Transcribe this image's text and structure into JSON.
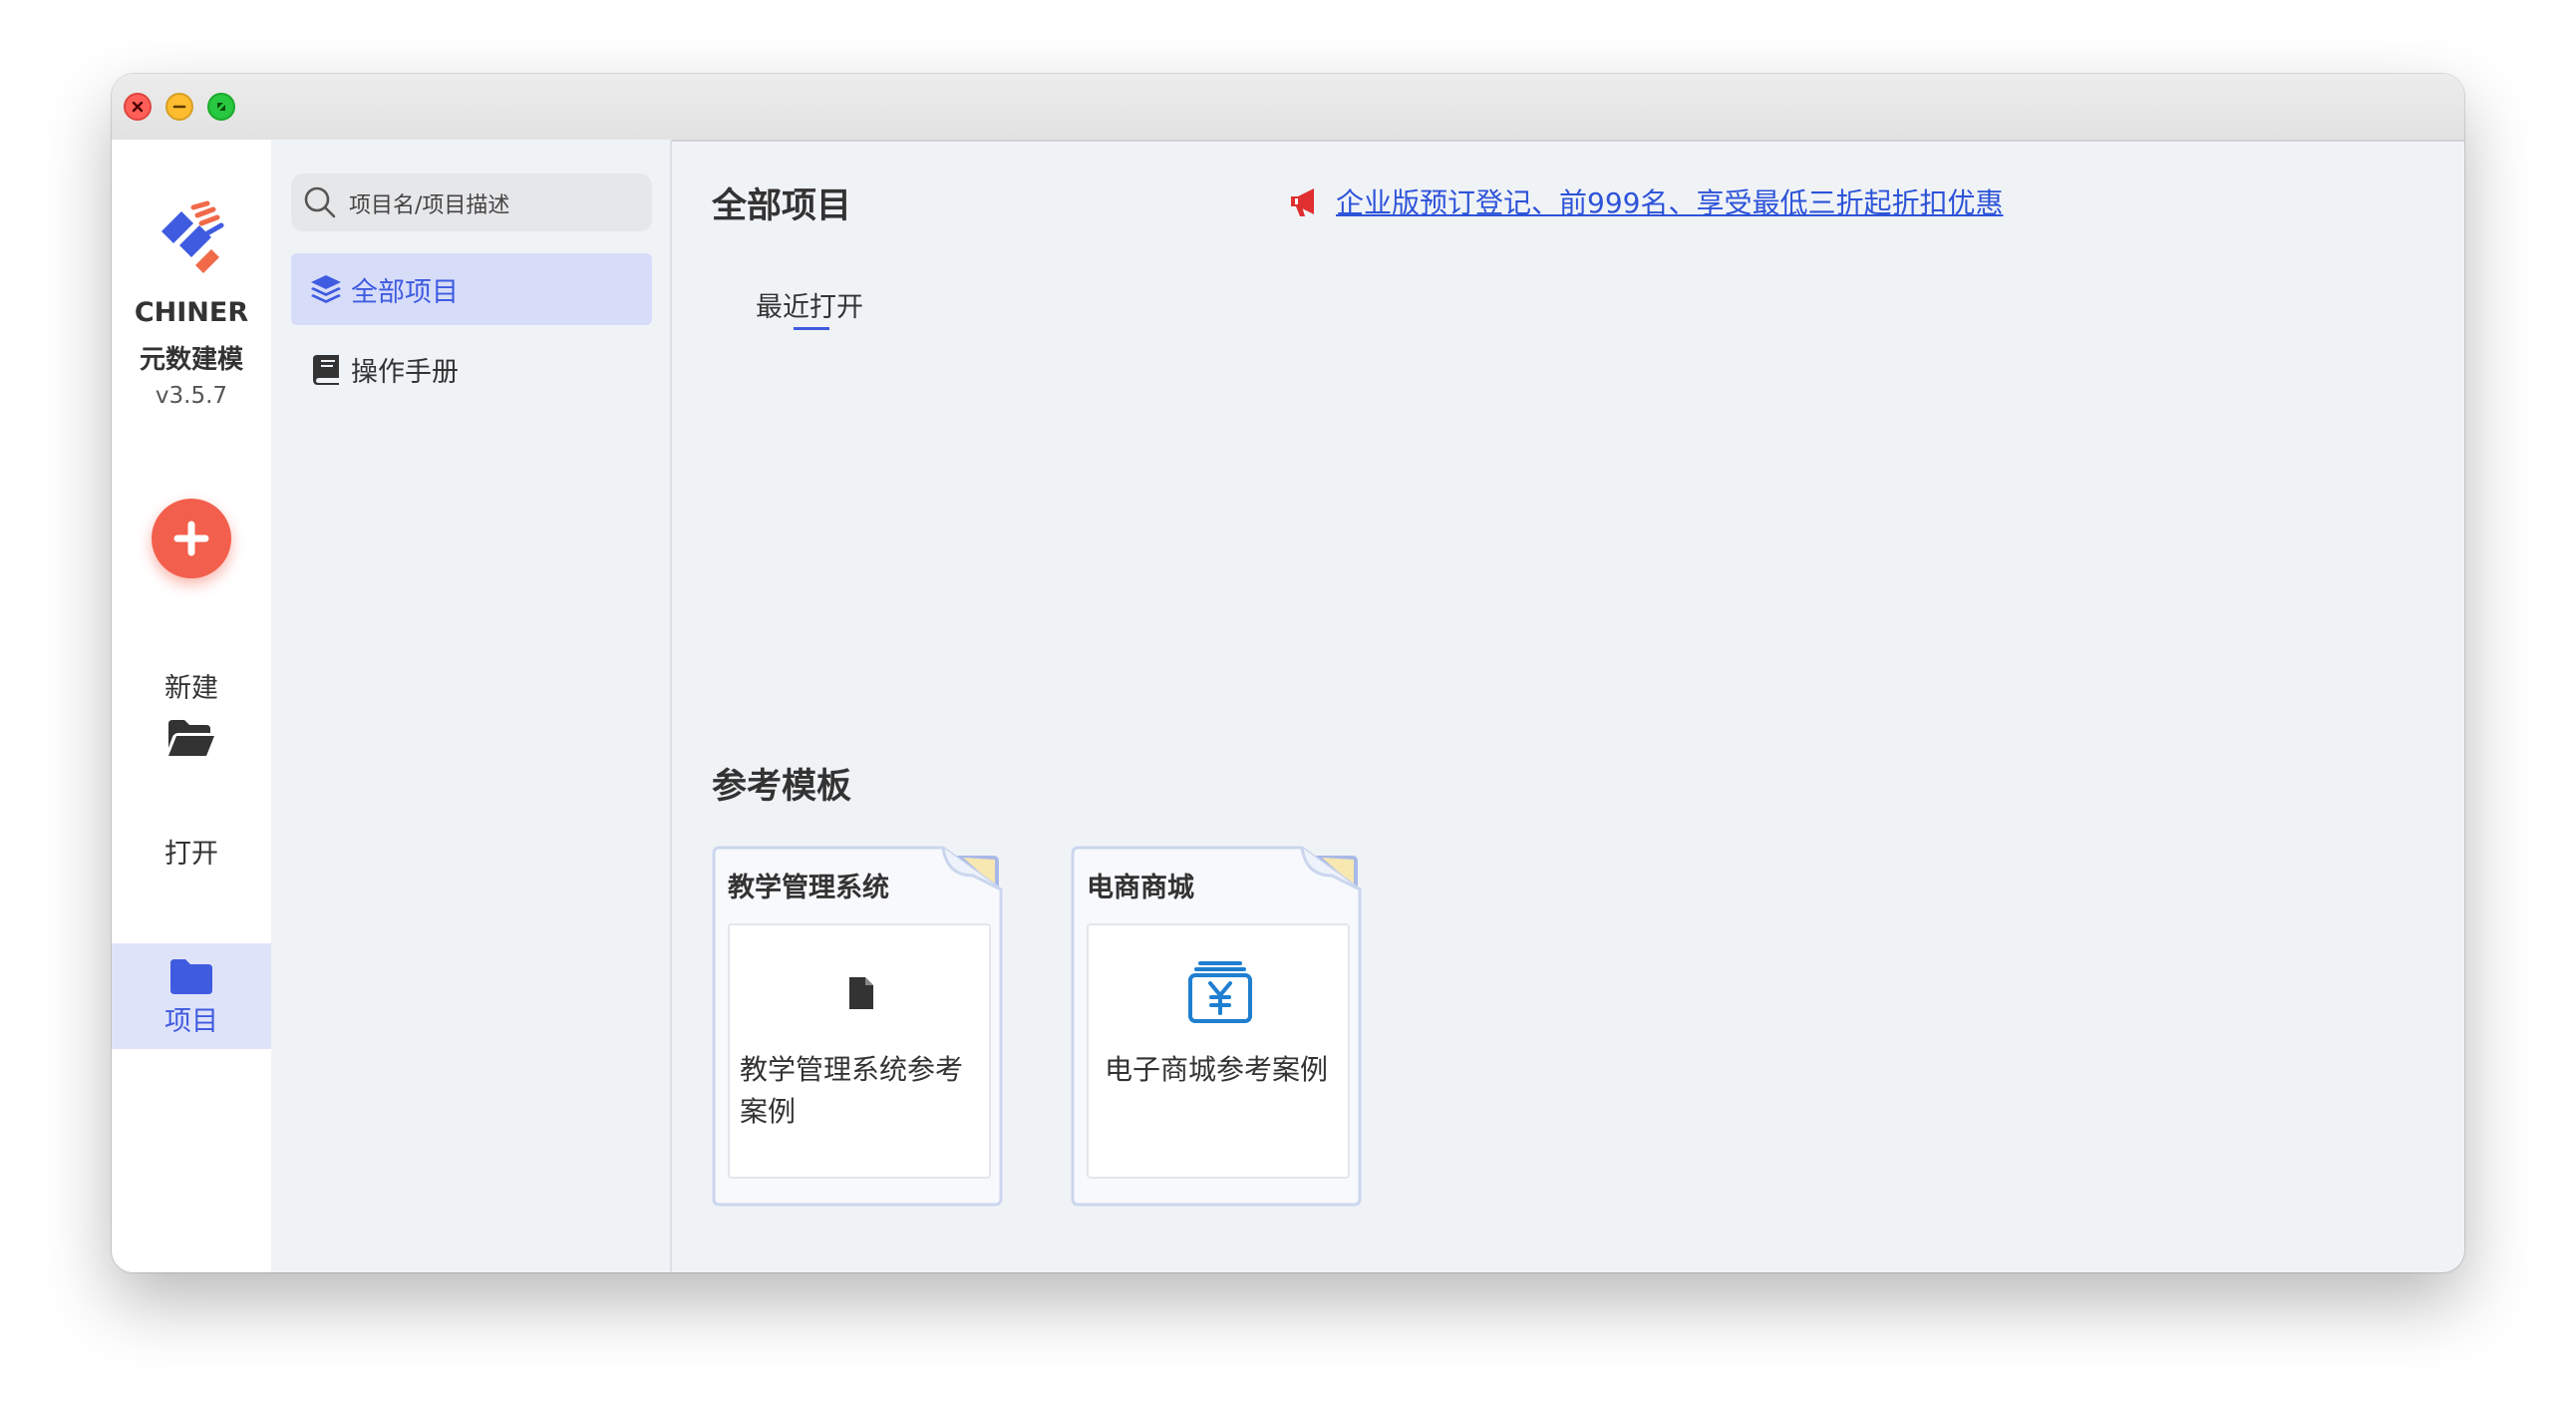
{
  "window": {
    "controls": {
      "close": "close-button",
      "minimize": "minimize-button",
      "zoom": "zoom-button"
    }
  },
  "app": {
    "name": "CHINER",
    "subtitle": "元数建模",
    "version": "v3.5.7"
  },
  "rail": {
    "new_label": "新建",
    "open_label": "打开",
    "project_label": "项目"
  },
  "sidebar": {
    "search_placeholder": "项目名/项目描述",
    "items": [
      {
        "label": "全部项目",
        "icon": "layers-icon",
        "active": true
      },
      {
        "label": "操作手册",
        "icon": "book-icon",
        "active": false
      }
    ]
  },
  "main": {
    "title": "全部项目",
    "promo_text": "企业版预订登记、前999名、享受最低三折起折扣优惠",
    "recent_tab": "最近打开",
    "templates_title": "参考模板",
    "templates": [
      {
        "title": "教学管理系统",
        "desc": "教学管理系统参考案例",
        "icon": "document-icon"
      },
      {
        "title": "电商商城",
        "desc": "电子商城参考案例",
        "icon": "cash-register-icon"
      }
    ]
  },
  "colors": {
    "accent": "#3f5be0",
    "active_bg": "#d7ddf9",
    "new_button": "#f25f4c",
    "promo_link": "#2d53d9",
    "promo_icon": "#e02f2f",
    "content_bg": "#f0f3f6"
  }
}
